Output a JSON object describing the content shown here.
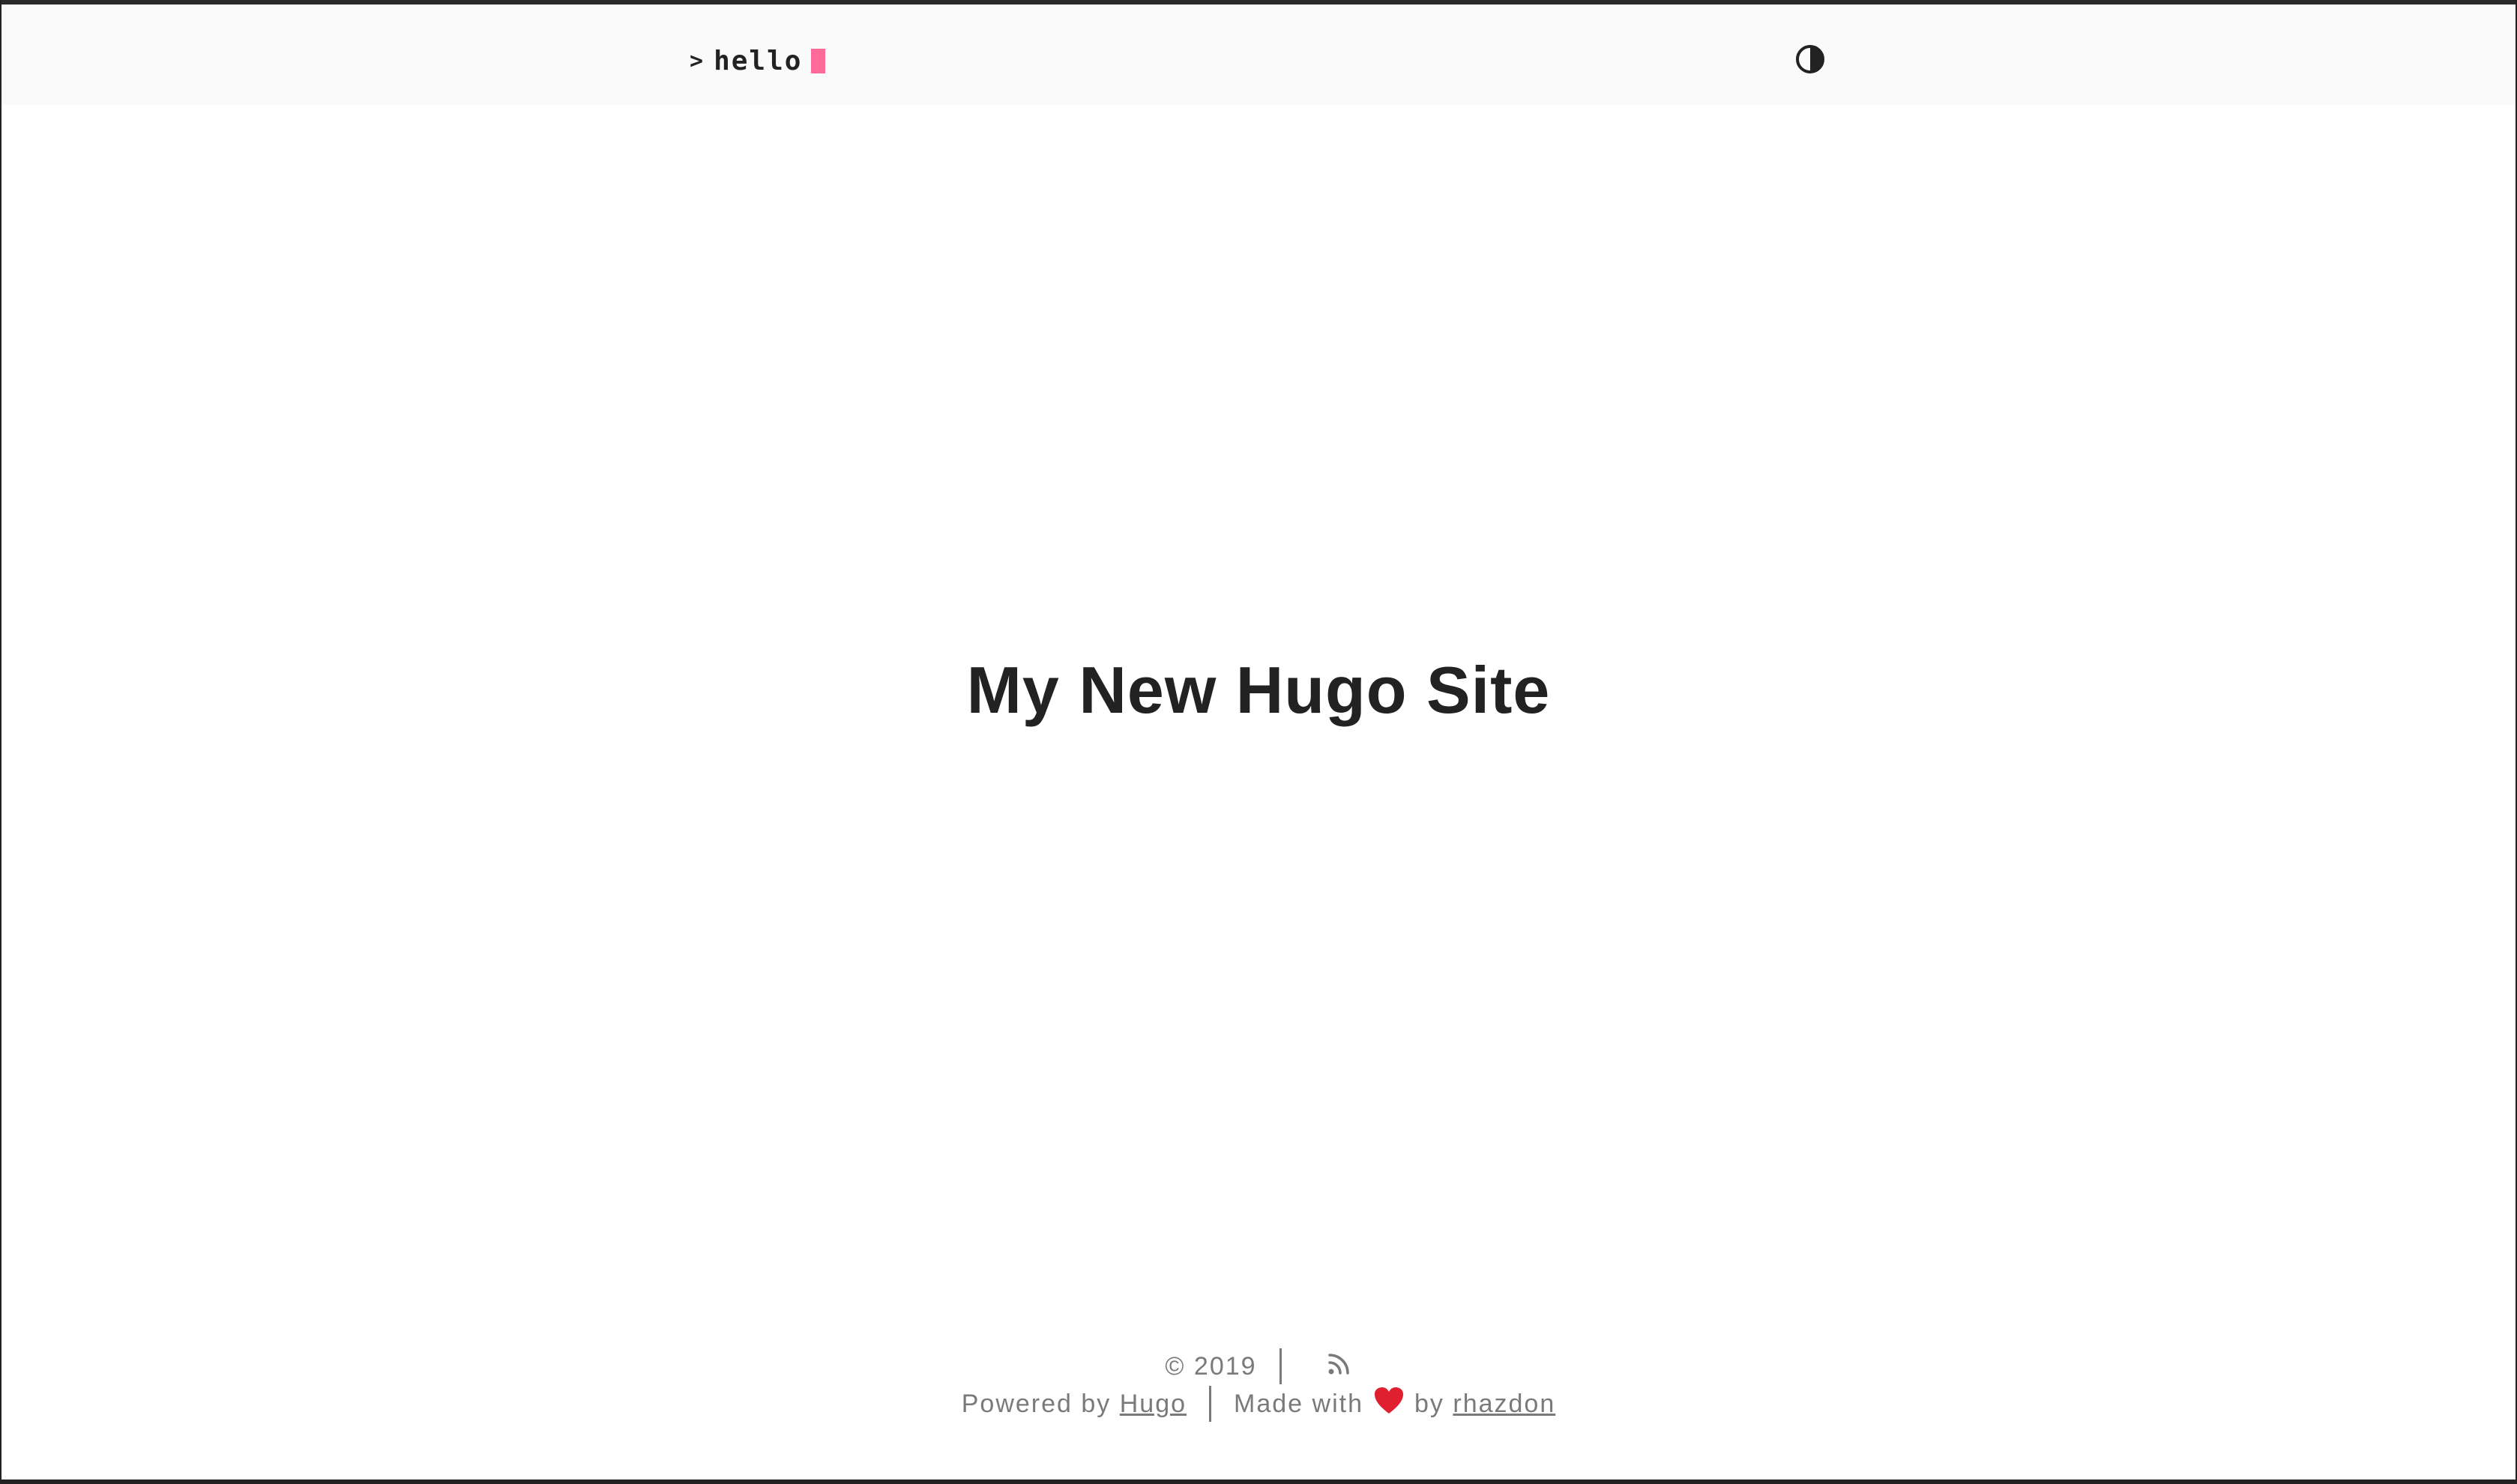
{
  "header": {
    "logo_prompt": ">",
    "logo_text": "hello",
    "theme_toggle_icon": "contrast-icon",
    "cursor_color": "#fe5186"
  },
  "main": {
    "title": "My New Hugo Site"
  },
  "footer": {
    "copyright": "© 2019",
    "rss_icon": "rss-icon",
    "powered_by": "Powered by",
    "hugo_link": "Hugo",
    "made_with": "Made with",
    "heart_icon": "heart-icon",
    "by": "by",
    "author_link": "rhazdon"
  }
}
